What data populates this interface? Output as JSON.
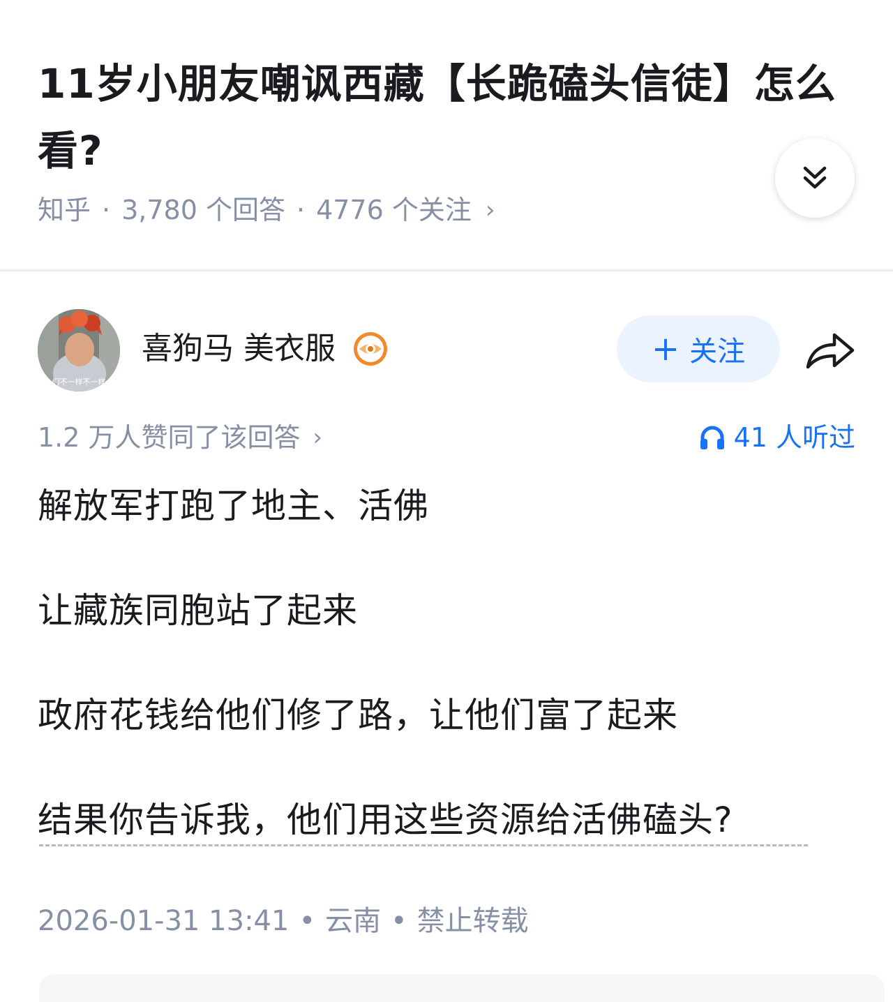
{
  "question": {
    "title": "11岁小朋友嘲讽西藏【长跪磕头信徒】怎么看?",
    "source": "知乎",
    "answer_count": "3,780 个回答",
    "follower_count": "4776 个关注",
    "separator": "·",
    "chevron": "›"
  },
  "answer": {
    "author": {
      "name": "喜狗马 美衣服",
      "avatar_caption": "们不一样不一样"
    },
    "follow_label": "关注",
    "follow_plus": "+",
    "upvote_summary": "1.2 万人赞同了该回答",
    "upvote_chevron": "›",
    "listen_count": "41 人听过",
    "paragraphs": [
      "解放军打跑了地主、活佛",
      "让藏族同胞站了起来",
      "政府花钱给他们修了路，让他们富了起来",
      "结果你告诉我，他们用这些资源给活佛磕头?"
    ],
    "date": "2026-01-31 13:41",
    "location": "云南",
    "copyright": "禁止转载",
    "separator": "•"
  },
  "colors": {
    "accent": "#1772f6",
    "follow_bg": "#ebf3ff",
    "meta_gray": "#8590a6",
    "text": "#191b1f",
    "badge_orange": "#f08a2c"
  },
  "icons": {
    "expand": "double-chevron-down-icon",
    "share": "share-arrow-icon",
    "listen": "headphones-icon",
    "badge": "eye-badge-icon"
  }
}
